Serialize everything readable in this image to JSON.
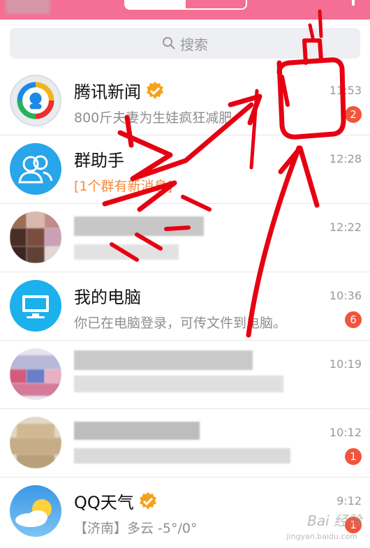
{
  "search": {
    "placeholder": "搜索"
  },
  "conversations": [
    {
      "name": "腾讯新闻",
      "preview": "800斤夫妻为生娃疯狂减肥",
      "time": "11:53",
      "badge": "2"
    },
    {
      "name": "群助手",
      "preview": "[1个群有新消息]",
      "time": "12:28"
    },
    {
      "name": "",
      "preview": "",
      "time": "12:22"
    },
    {
      "name": "我的电脑",
      "preview": "你已在电脑登录，可传文件到电脑。",
      "time": "10:36",
      "badge": "6"
    },
    {
      "name": "",
      "preview": "",
      "time": "10:19"
    },
    {
      "name": "",
      "preview": "",
      "time": "10:12",
      "badge": "1"
    },
    {
      "name": "QQ天气",
      "preview": "【济南】多云 -5°/0°",
      "time": "9:12",
      "badge": "1"
    }
  ],
  "watermark": {
    "main": "Bai 经验",
    "sub": "jingyan.baidu.com"
  },
  "colors": {
    "header": "#f46f93",
    "badge": "#f2543c",
    "accent": "#29a5ea",
    "annotation": "#e60012"
  },
  "icons": [
    "search-icon",
    "verified-icon",
    "tencent-news-icon",
    "group-assistant-icon",
    "computer-icon",
    "weather-icon"
  ]
}
